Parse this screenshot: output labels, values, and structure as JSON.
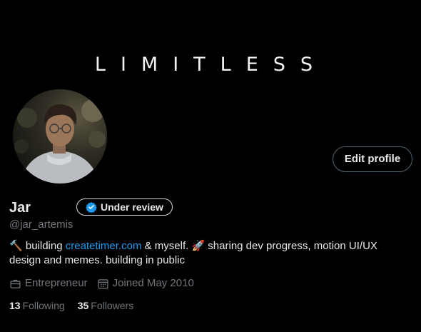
{
  "banner": {
    "text": "LIMITLESS"
  },
  "profile": {
    "name": "Jar",
    "badge_label": "Under review",
    "handle": "@jar_artemis",
    "edit_button_label": "Edit profile",
    "bio": {
      "prefix_emoji": "🔨",
      "text_before_link": " building ",
      "link_text": "createtimer.com",
      "text_after_link": " & myself. ",
      "rocket_emoji": "🚀",
      "text_end": " sharing dev progress, motion UI/UX design and memes. building in public"
    },
    "meta": {
      "category": "Entrepreneur",
      "joined": "Joined May 2010"
    },
    "stats": {
      "following_count": "13",
      "following_label": "Following",
      "followers_count": "35",
      "followers_label": "Followers"
    }
  },
  "icons": {
    "badge": "verified-check-icon",
    "category": "briefcase-icon",
    "joined": "calendar-icon"
  },
  "colors": {
    "background": "#000000",
    "text_primary": "#e7e9ea",
    "text_secondary": "#71767b",
    "link": "#1d9bf0",
    "border": "#536471"
  }
}
